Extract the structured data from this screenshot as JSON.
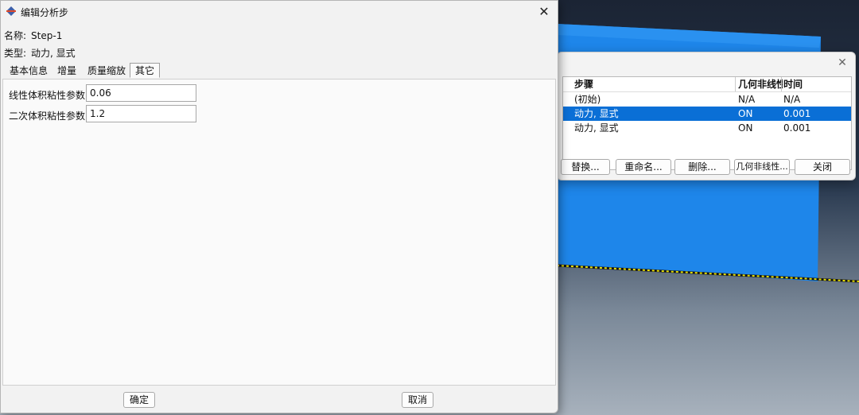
{
  "edit_dialog": {
    "title": "编辑分析步",
    "name_label": "名称:",
    "name_value": "Step-1",
    "type_label": "类型:",
    "type_value": "动力, 显式",
    "tabs": [
      {
        "label": "基本信息",
        "active": false
      },
      {
        "label": "增量",
        "active": false
      },
      {
        "label": "质量缩放",
        "active": false
      },
      {
        "label": "其它",
        "active": true
      }
    ],
    "fields": {
      "linear_label": "线性体积粘性参数:",
      "linear_value": "0.06",
      "quadratic_label": "二次体积粘性参数:",
      "quadratic_value": "1.2"
    },
    "ok_label": "确定",
    "cancel_label": "取消"
  },
  "step_manager": {
    "headers": [
      "步骤",
      "几何非线性",
      "时间"
    ],
    "rows": [
      {
        "step": "(初始)",
        "nlgeom": "N/A",
        "time": "N/A",
        "selected": false
      },
      {
        "step": "动力, 显式",
        "nlgeom": "ON",
        "time": "0.001",
        "selected": true
      },
      {
        "step": "动力, 显式",
        "nlgeom": "ON",
        "time": "0.001",
        "selected": false
      }
    ],
    "buttons": {
      "replace": "替换...",
      "rename": "重命名...",
      "delete": "删除...",
      "nlgeom": "几何非线性...",
      "close": "关闭"
    }
  },
  "colors": {
    "selection": "#0a6fd6",
    "plate": "#1e86ea",
    "edge_dots": "#e8e000"
  }
}
